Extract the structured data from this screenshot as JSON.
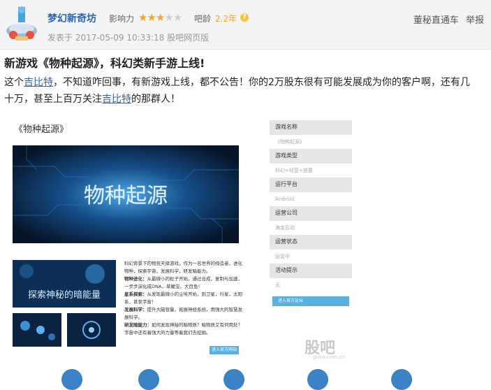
{
  "header": {
    "username": "梦幻新奇坊",
    "influence_label": "影响力",
    "influence_rating": 3,
    "influence_max": 5,
    "age_label": "吧龄",
    "age_value": "2.2年",
    "age_help_icon": "?",
    "post_time": "发表于 2017-05-09 10:33:18 股吧网页版",
    "actions": [
      "董秘直通车",
      "举报"
    ],
    "avatar_icon": "avatar-figure-icon"
  },
  "post": {
    "title": "新游戏《物种起源》，科幻类新手游上线!",
    "body_segments": [
      {
        "text": "这个",
        "link": false
      },
      {
        "text": "吉比特",
        "link": true
      },
      {
        "text": "，不知道咋回事，有新游戏上线，都不公告！你的2万股东很有可能发展成为你的客户啊，还有几十万，甚至上百万关注",
        "link": false
      },
      {
        "text": "吉比特",
        "link": true
      },
      {
        "text": "的那群人！",
        "link": false
      }
    ]
  },
  "poster": {
    "title": "《物种起源》",
    "hero_text": "物种起源",
    "banner_text": "探索神秘的暗能量",
    "button": "进入官方网站",
    "description": [
      {
        "label": "",
        "text": "科幻背景下的物竞天择游戏，作为一名世界的缔造者，进化物种，探索宇宙，发展科学，研发暗能力。"
      },
      {
        "label": "物种进化：",
        "text": "从最微小的粒子开始，通过合成，复制与加速，一步步演化成DNA，草履虫，大目鱼！"
      },
      {
        "label": "星系探索：",
        "text": "从发现最微小的尘埃开始，到卫星，行星，太阳系，甚至宇宙！"
      },
      {
        "label": "发展科学：",
        "text": "提升大脑容量，拓展神经系统，用强大的智慧发展科学。"
      },
      {
        "label": "研发暗能力：",
        "text": "如何发现神秘的暗物质？暗物质又有何用处？宇宙中还有着强大的力量等着我们去挖掘。"
      }
    ]
  },
  "sidebar": {
    "rows": [
      {
        "label": "游戏名称",
        "value": "《物种起源》"
      },
      {
        "label": "游戏类型",
        "value": "科幻+经营+放置"
      },
      {
        "label": "运行平台",
        "value": "Android"
      },
      {
        "label": "运营公司",
        "value": "海金互动"
      },
      {
        "label": "运营状态",
        "value": "运营中"
      },
      {
        "label": "活动提示",
        "value": "无"
      }
    ],
    "button": "进入官方论坛"
  },
  "watermark": {
    "logo": "股吧",
    "url": "guba.com.cn"
  },
  "colors": {
    "link": "#2d64b3",
    "star": "#f5a623",
    "accent": "#5bb0dd"
  }
}
